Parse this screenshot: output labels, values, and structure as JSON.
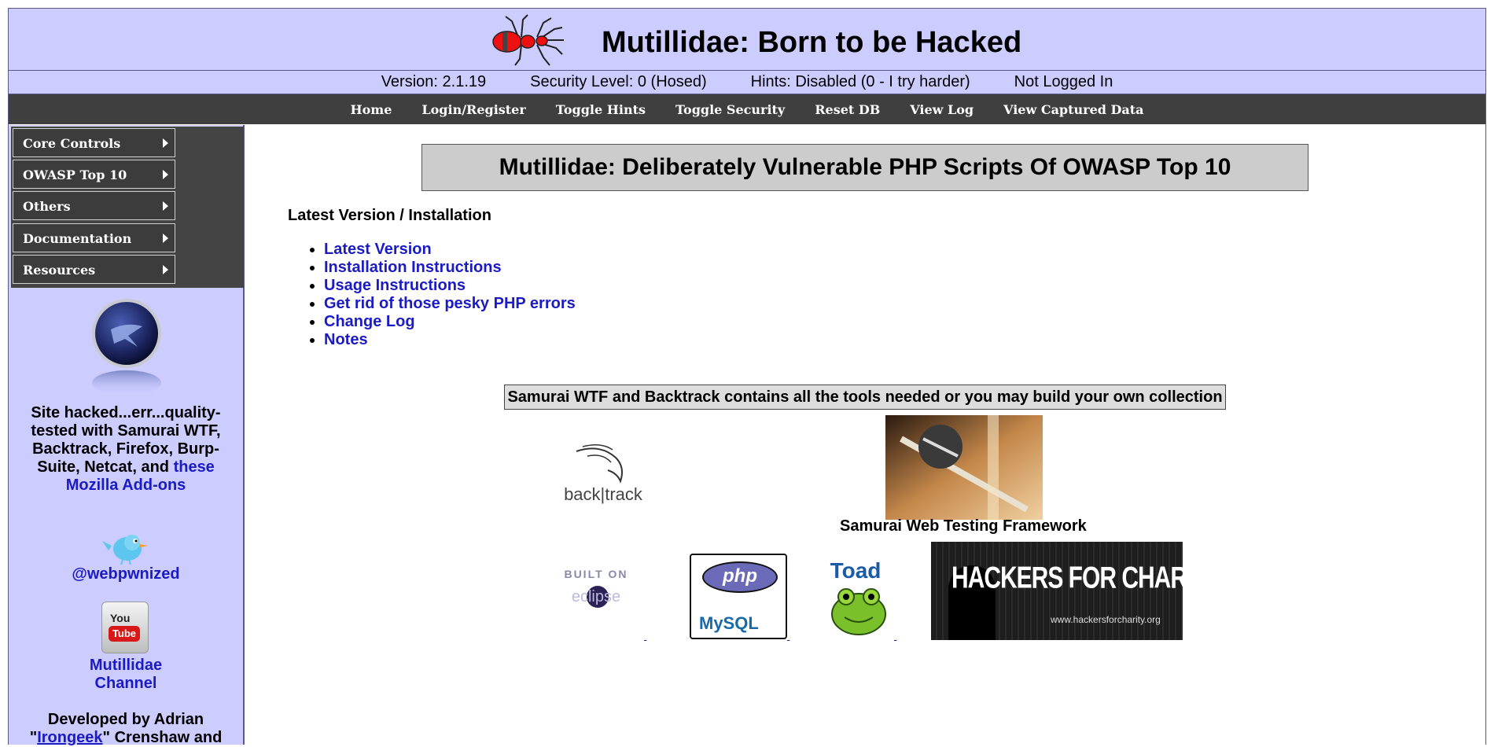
{
  "header": {
    "title": "Mutillidae: Born to be Hacked"
  },
  "status_bar": {
    "version": "Version: 2.1.19",
    "security_level": "Security Level: 0 (Hosed)",
    "hints": "Hints: Disabled (0 - I try harder)",
    "login_status": "Not Logged In"
  },
  "nav": {
    "items": [
      "Home",
      "Login/Register",
      "Toggle Hints",
      "Toggle Security",
      "Reset DB",
      "View Log",
      "View Captured Data"
    ]
  },
  "sidebar": {
    "menu": [
      "Core Controls",
      "OWASP Top 10",
      "Others",
      "Documentation",
      "Resources"
    ],
    "tested_text": "Site hacked...err...quality-tested with Samurai WTF, Backtrack, Firefox, Burp-Suite, Netcat, and ",
    "addons_link": "these Mozilla Add-ons",
    "twitter_link": "@webpwnized",
    "youtube_link_line1": "Mutillidae",
    "youtube_link_line2": "Channel",
    "developed_prefix": "Developed by Adrian",
    "developed_link": "Irongeek",
    "developed_suffix": "\" Crenshaw and",
    "developed_quote": "\""
  },
  "main": {
    "title": "Mutillidae: Deliberately Vulnerable PHP Scripts Of OWASP Top 10",
    "section_label": "Latest Version / Installation",
    "links": [
      "Latest Version",
      "Installation Instructions",
      "Usage Instructions",
      "Get rid of those pesky PHP errors",
      "Change Log",
      "Notes"
    ],
    "tools_text": "Samurai WTF and Backtrack contains all the tools needed or you may build your own collection",
    "samurai_caption": "Samurai Web Testing Framework",
    "logos": {
      "backtrack": "back|track",
      "eclipse_top": "BUILT ON",
      "eclipse_bottom": "eclipse",
      "php": "php",
      "mysql": "MySQL",
      "toad": "Toad",
      "hfc": "HACKERS FOR CHARITY",
      "hfc_url": "www.hackersforcharity.org",
      "youtube_you": "You",
      "youtube_tube": "Tube"
    }
  },
  "colors": {
    "header_bg": "#ccccff",
    "nav_bg": "#3f3f3f",
    "link": "#1b1bc4"
  }
}
